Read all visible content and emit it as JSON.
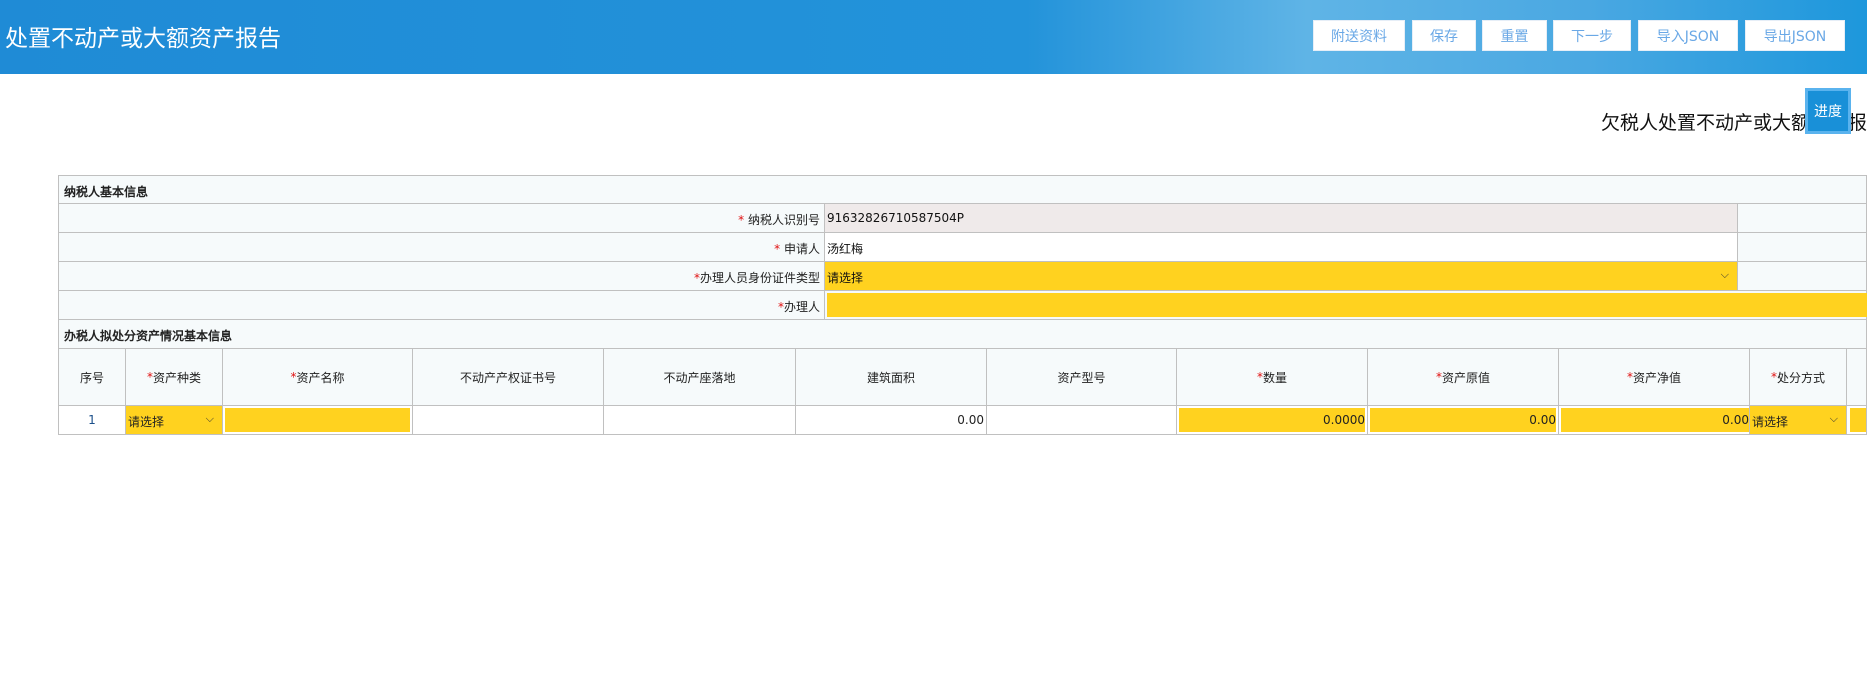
{
  "header": {
    "title": "处置不动产或大额资产报告",
    "buttons": [
      "附送资料",
      "保存",
      "重置",
      "下一步",
      "导入JSON",
      "导出JSON"
    ]
  },
  "subtitle": "欠税人处置不动产或大额资产报告",
  "progress_label": "进度",
  "taxpayer_section": {
    "title": "纳税人基本信息",
    "fields": [
      {
        "req": "* ",
        "label": "纳税人识别号",
        "value": "91632826710587504P"
      },
      {
        "req": "* ",
        "label": "申请人",
        "value": "汤红梅"
      },
      {
        "req": "*",
        "label": "办理人员身份证件类型",
        "value": "请选择"
      },
      {
        "req": "*",
        "label": "办理人",
        "value": ""
      }
    ]
  },
  "asset_section": {
    "title": "办税人拟处分资产情况基本信息",
    "columns": [
      {
        "req": "",
        "label": "序号"
      },
      {
        "req": "* ",
        "label": "资产种类"
      },
      {
        "req": "* ",
        "label": "资产名称"
      },
      {
        "req": "",
        "label": "不动产产权证书号"
      },
      {
        "req": "",
        "label": "不动产座落地"
      },
      {
        "req": "",
        "label": "建筑面积"
      },
      {
        "req": "",
        "label": "资产型号"
      },
      {
        "req": "* ",
        "label": "数量"
      },
      {
        "req": "* ",
        "label": "资产原值"
      },
      {
        "req": "* ",
        "label": "资产净值"
      },
      {
        "req": "* ",
        "label": "处分方式"
      }
    ],
    "rows": [
      {
        "index": "1",
        "asset_type": "请选择",
        "asset_name": "",
        "cert_no": "",
        "location": "",
        "area": "0.00",
        "model": "",
        "quantity": "0.0000",
        "original_value": "0.00",
        "net_value": "0.00",
        "disposal": "请选择"
      }
    ]
  },
  "colors": {
    "header": "#1f8bd6",
    "required_fill": "#ffd21f",
    "readonly": "#efeaea"
  }
}
